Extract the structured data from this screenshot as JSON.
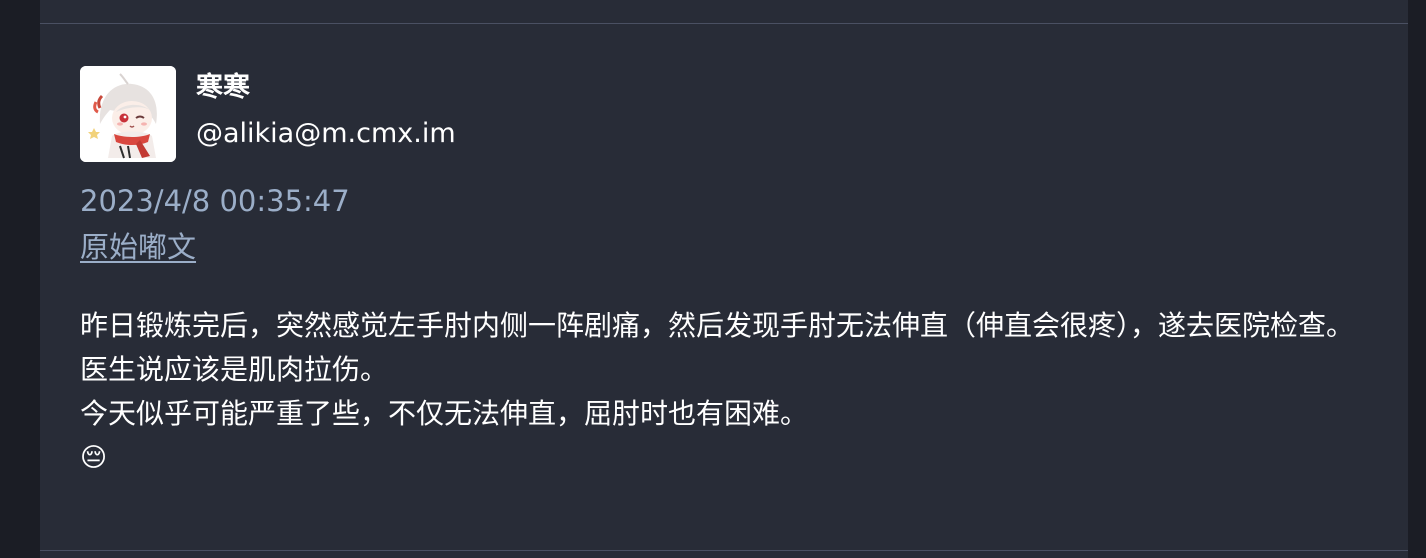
{
  "status": {
    "account": {
      "display_name": "寒寒",
      "handle": "@alikia@m.cmx.im"
    },
    "timestamp": "2023/4/8 00:35:47",
    "original_link_label": "原始嘟文",
    "content": {
      "paragraph_1": "昨日锻炼完后，突然感觉左手肘内侧一阵剧痛，然后发现手肘无法伸直（伸直会很疼），遂去医院检查。医生说应该是肌肉拉伤。",
      "paragraph_2": "今天似乎可能严重了些，不仅无法伸直，屈肘时也有困难。",
      "emoji": "😔"
    }
  },
  "colors": {
    "background": "#282c37",
    "gutter": "#1b1d25",
    "divider": "#4a5062",
    "text_primary": "#ffffff",
    "text_secondary": "#9baec8"
  }
}
